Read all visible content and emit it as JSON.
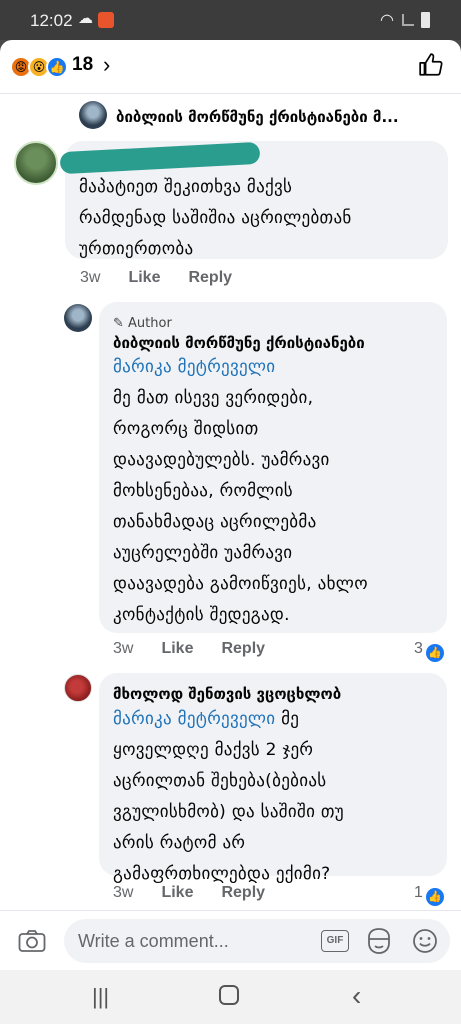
{
  "status_bar": {
    "time": "12:02"
  },
  "header": {
    "reaction_count": "18"
  },
  "post": {
    "page_name": "ბიბლიის მორწმუნე ქრისტიანები მ..."
  },
  "comments": [
    {
      "name": "",
      "text_lines": [
        "მაპატიეთ შეკითხვა მაქვს",
        "რამდენად საშიშია აცრილებთან",
        "ურთიერთობა"
      ],
      "time": "3w",
      "like_label": "Like",
      "reply_label": "Reply"
    },
    {
      "author_tag": "Author",
      "name": "ბიბლიის მორწმუნე ქრისტიანები",
      "mention": "მარიკა მეტრეველი",
      "text_lines": [
        "მე მათ ისევე ვერიდები,",
        "როგორც შიდსით",
        "დაავადებულებს. უამრავი",
        "მოხსენებაა, რომლის",
        "თანახმადაც აცრილებმა",
        "აუცრელებში უამრავი",
        "დაავადება გამოიწვიეს, ახლო",
        "კონტაქტის შედეგად."
      ],
      "time": "3w",
      "like_label": "Like",
      "reply_label": "Reply",
      "like_count": "3"
    },
    {
      "name": "მხოლოდ შენთვის ვცოცხლობ",
      "mention": "მარიკა მეტრეველი",
      "mention_suffix": " მე",
      "text_lines": [
        "ყოველდღე მაქვს 2 ჯერ",
        "აცრილთან შეხება(ბებიას",
        "ვგულისხმობ)  და  საშიში თუ",
        "არის რატომ არ",
        "გამაფრთხილებდა ექიმი?"
      ],
      "time": "3w",
      "like_label": "Like",
      "reply_label": "Reply",
      "like_count": "1"
    }
  ],
  "composer": {
    "placeholder": "Write a comment...",
    "gif_label": "GIF"
  },
  "colors": {
    "accent": "#1877f2",
    "mention": "#1d72b8",
    "bubble": "#f0f2f5"
  },
  "icons": [
    "cloud-icon",
    "wifi-icon",
    "chevron-right-icon",
    "thumbs-up-icon",
    "camera-icon",
    "gif-icon",
    "sticker-icon",
    "emoji-icon",
    "recent-apps-icon",
    "home-icon",
    "back-icon"
  ]
}
